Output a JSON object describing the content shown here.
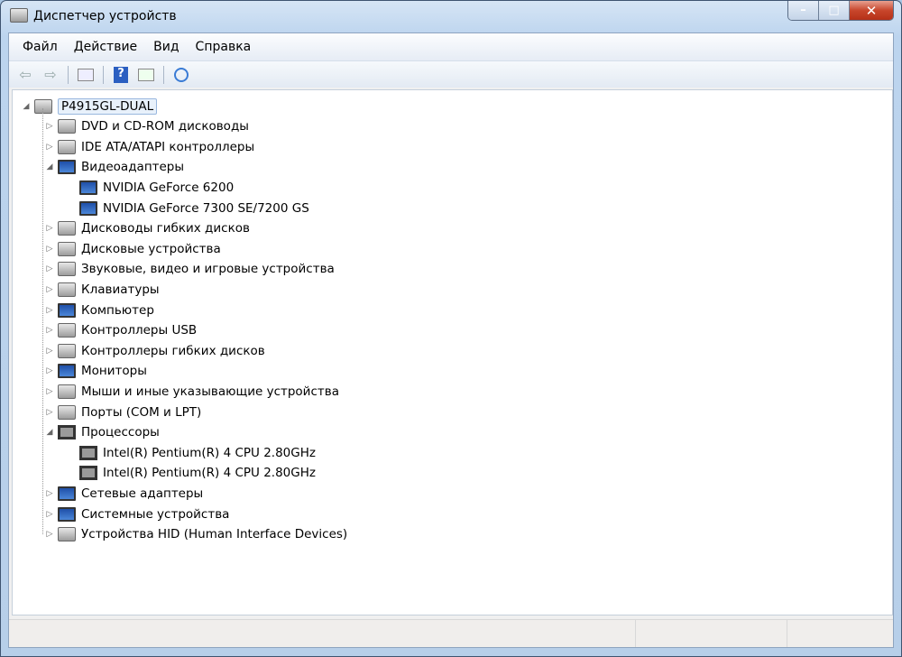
{
  "window": {
    "title": "Диспетчер устройств",
    "minimize": "–",
    "maximize": "□",
    "close": "✕"
  },
  "menu": [
    "Файл",
    "Действие",
    "Вид",
    "Справка"
  ],
  "toolbar": [
    "back-icon",
    "forward-icon",
    "show-hide-console-tree-icon",
    "help-icon",
    "action-pane-icon",
    "scan-hardware-icon"
  ],
  "tree": {
    "root": "P4915GL-DUAL",
    "items": [
      {
        "label": "DVD и CD-ROM дисководы",
        "expanded": false,
        "icon": "gen"
      },
      {
        "label": "IDE ATA/ATAPI контроллеры",
        "expanded": false,
        "icon": "gen"
      },
      {
        "label": "Видеоадаптеры",
        "expanded": true,
        "icon": "mon",
        "children": [
          "NVIDIA GeForce 6200",
          "NVIDIA GeForce 7300 SE/7200 GS"
        ]
      },
      {
        "label": "Дисководы гибких дисков",
        "expanded": false,
        "icon": "gen"
      },
      {
        "label": "Дисковые устройства",
        "expanded": false,
        "icon": "gen"
      },
      {
        "label": "Звуковые, видео и игровые устройства",
        "expanded": false,
        "icon": "gen"
      },
      {
        "label": "Клавиатуры",
        "expanded": false,
        "icon": "gen"
      },
      {
        "label": "Компьютер",
        "expanded": false,
        "icon": "mon"
      },
      {
        "label": "Контроллеры USB",
        "expanded": false,
        "icon": "gen"
      },
      {
        "label": "Контроллеры гибких дисков",
        "expanded": false,
        "icon": "gen"
      },
      {
        "label": "Мониторы",
        "expanded": false,
        "icon": "mon"
      },
      {
        "label": "Мыши и иные указывающие устройства",
        "expanded": false,
        "icon": "gen"
      },
      {
        "label": "Порты (COM и LPT)",
        "expanded": false,
        "icon": "gen"
      },
      {
        "label": "Процессоры",
        "expanded": true,
        "icon": "cpu",
        "children": [
          "Intel(R) Pentium(R) 4 CPU 2.80GHz",
          "Intel(R) Pentium(R) 4 CPU 2.80GHz"
        ]
      },
      {
        "label": "Сетевые адаптеры",
        "expanded": false,
        "icon": "mon"
      },
      {
        "label": "Системные устройства",
        "expanded": false,
        "icon": "mon"
      },
      {
        "label": "Устройства HID (Human Interface Devices)",
        "expanded": false,
        "icon": "gen"
      }
    ]
  }
}
